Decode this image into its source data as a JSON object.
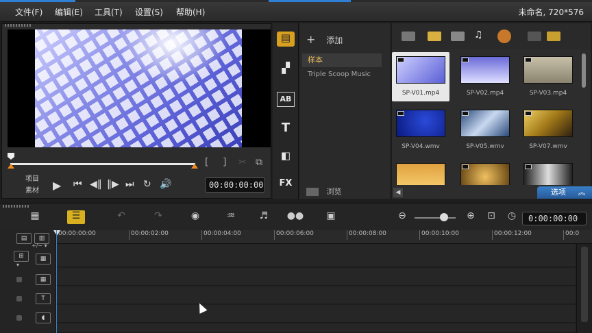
{
  "menu": {
    "file": "文件(F)",
    "edit": "编辑(E)",
    "tools": "工具(T)",
    "settings": "设置(S)",
    "help": "帮助(H)"
  },
  "project_info": "未命名, 720*576",
  "preview": {
    "mode_project": "项目",
    "mode_clip": "素材",
    "timecode": "00:00:00:00"
  },
  "library": {
    "add_label": "添加",
    "sample_label": "样本",
    "triple_scoop": "Triple Scoop Music",
    "browse_label": "浏览",
    "options_label": "选项",
    "thumbnails": [
      {
        "name": "SP-V01.mp4"
      },
      {
        "name": "SP-V02.mp4"
      },
      {
        "name": "SP-V03.mp4"
      },
      {
        "name": "SP-V04.wmv"
      },
      {
        "name": "SP-V05.wmv"
      },
      {
        "name": "SP-V07.wmv"
      }
    ]
  },
  "timeline": {
    "timecode": "0:00:00:00",
    "ticks": [
      "00:00:00:00",
      "00:00:02:00",
      "00:00:04:00",
      "00:00:06:00",
      "00:00:08:00",
      "00:00:10:00",
      "00:00:12:00",
      "00:0"
    ]
  },
  "colors": {
    "accent": "#2f7fd6",
    "selected_item_text": "#f0c060",
    "marker": "#f08a20"
  }
}
